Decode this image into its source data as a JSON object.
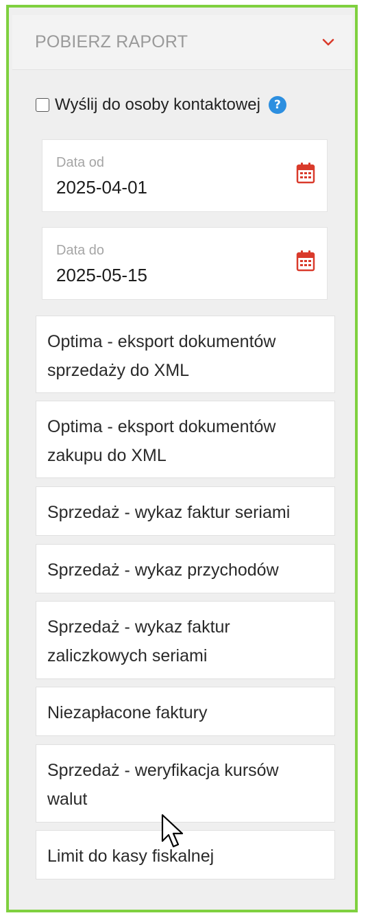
{
  "panel": {
    "title": "POBIERZ RAPORT",
    "chevron_icon": "chevron-down-icon",
    "accent_color": "#d93a2b",
    "frame_color": "#7fd03f"
  },
  "contact": {
    "label": "Wyślij do osoby kontaktowej",
    "checked": false,
    "help_icon": "?"
  },
  "date_from": {
    "label": "Data od",
    "value": "2025-04-01",
    "icon": "calendar-icon"
  },
  "date_to": {
    "label": "Data do",
    "value": "2025-05-15",
    "icon": "calendar-icon"
  },
  "reports": [
    {
      "line1": "Optima - eksport dokumentów",
      "line2": "sprzedaży do XML"
    },
    {
      "line1": "Optima - eksport dokumentów",
      "line2": "zakupu do XML"
    },
    {
      "line1": "Sprzedaż - wykaz faktur seriami",
      "line2": ""
    },
    {
      "line1": "Sprzedaż - wykaz przychodów",
      "line2": ""
    },
    {
      "line1": "Sprzedaż - wykaz faktur",
      "line2": "zaliczkowych seriami"
    },
    {
      "line1": "Niezapłacone faktury",
      "line2": ""
    },
    {
      "line1": "Sprzedaż - weryfikacja kursów",
      "line2": "walut"
    },
    {
      "line1": "Limit do kasy fiskalnej",
      "line2": ""
    }
  ]
}
